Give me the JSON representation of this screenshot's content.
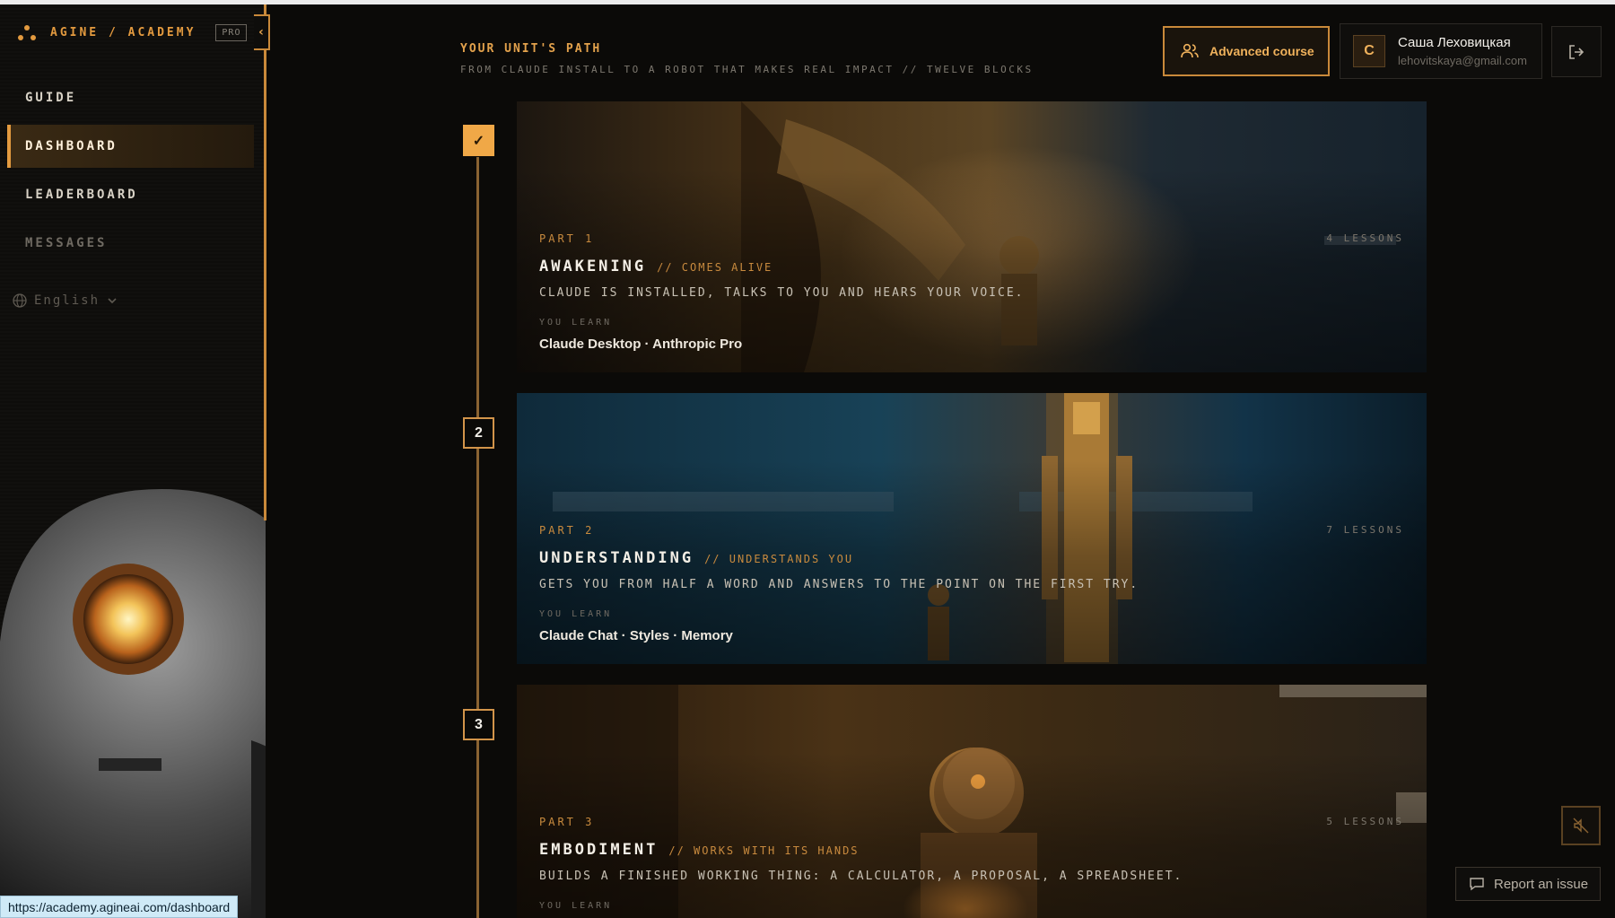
{
  "brand": {
    "name": "AGINE / ACADEMY",
    "badge": "PRO"
  },
  "sidebar": {
    "items": [
      {
        "label": "GUIDE",
        "state": "normal"
      },
      {
        "label": "DASHBOARD",
        "state": "active"
      },
      {
        "label": "LEADERBOARD",
        "state": "normal"
      },
      {
        "label": "MESSAGES",
        "state": "disabled"
      }
    ],
    "language": "English",
    "collapse_icon": "chevron-left-icon"
  },
  "header": {
    "title": "YOUR UNIT'S PATH",
    "subtitle": "FROM CLAUDE INSTALL TO A ROBOT THAT MAKES REAL IMPACT // TWELVE BLOCKS",
    "course_button": "Advanced course",
    "user": {
      "initial": "C",
      "name": "Саша Леховицкая",
      "email": "lehovitskaya@gmail.com"
    }
  },
  "path": {
    "parts": [
      {
        "step": "✓",
        "status": "completed",
        "part": "PART 1",
        "title": "AWAKENING",
        "subtitle": "// COMES ALIVE",
        "description": "CLAUDE IS INSTALLED, TALKS TO YOU AND HEARS YOUR VOICE.",
        "lessons": "4 LESSONS",
        "learn_label": "YOU LEARN",
        "learn": "Claude Desktop · Anthropic Pro"
      },
      {
        "step": "2",
        "status": "available",
        "part": "PART 2",
        "title": "UNDERSTANDING",
        "subtitle": "// UNDERSTANDS YOU",
        "description": "GETS YOU FROM HALF A WORD AND ANSWERS TO THE POINT ON THE FIRST TRY.",
        "lessons": "7 LESSONS",
        "learn_label": "YOU LEARN",
        "learn": "Claude Chat · Styles · Memory"
      },
      {
        "step": "3",
        "status": "available",
        "part": "PART 3",
        "title": "EMBODIMENT",
        "subtitle": "// WORKS WITH ITS HANDS",
        "description": "BUILDS A FINISHED WORKING THING: A CALCULATOR, A PROPOSAL, A SPREADSHEET.",
        "lessons": "5 LESSONS",
        "learn_label": "YOU LEARN",
        "learn": ""
      }
    ]
  },
  "footer": {
    "report_button": "Report an issue",
    "status_url": "https://academy.agineai.com/dashboard"
  },
  "colors": {
    "accent": "#e39a3f",
    "background": "#0b0a08",
    "status_bar": "#cfeaf7"
  }
}
